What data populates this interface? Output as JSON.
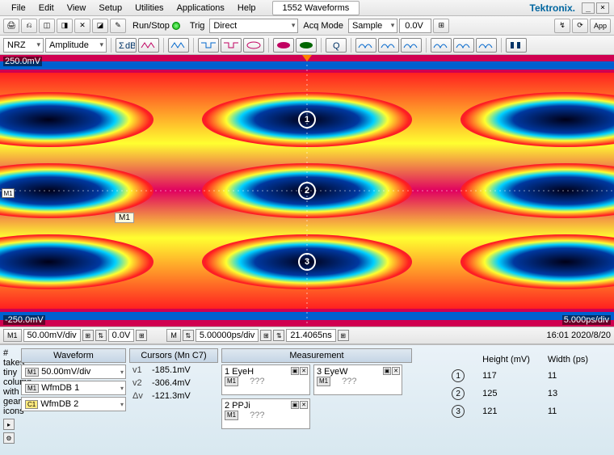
{
  "menu": {
    "items": [
      "File",
      "Edit",
      "View",
      "Setup",
      "Utilities",
      "Applications",
      "Help"
    ],
    "title": "1552 Waveforms",
    "brand": "Tektronix."
  },
  "toolbar1": {
    "runstop": "Run/Stop",
    "trig_label": "Trig",
    "trig_mode": "Direct",
    "acq_label": "Acq Mode",
    "acq_mode": "Sample",
    "voltage": "0.0V",
    "app_label": "App"
  },
  "toolbar2": {
    "mode_left": "NRZ",
    "mode_right": "Amplitude"
  },
  "plot": {
    "ytop": "250.0mV",
    "ybot": "-250.0mV",
    "timediv": "5.000ps/div",
    "m1_label": "M1",
    "markers": [
      "1",
      "2",
      "3"
    ]
  },
  "statusbar": {
    "m1_tag": "M1",
    "vdiv": "50.00mV/div",
    "voff": "0.0V",
    "m_tag": "M",
    "tdiv": "5.00000ps/div",
    "tpos": "21.4065ns",
    "datetime": "16:01 2020/8/20"
  },
  "panel": {
    "waveform": {
      "header": "Waveform",
      "items": [
        {
          "tag": "M1",
          "label": "50.00mV/div",
          "tagclass": ""
        },
        {
          "tag": "M1",
          "label": "WfmDB 1",
          "tagclass": ""
        },
        {
          "tag": "C1",
          "label": "WfmDB 2",
          "tagclass": "y"
        }
      ]
    },
    "cursors": {
      "header": "Cursors (Mn C7)",
      "rows": [
        {
          "k": "v1",
          "v": "-185.1mV"
        },
        {
          "k": "v2",
          "v": "-306.4mV"
        },
        {
          "k": "Δv",
          "v": "-121.3mV"
        }
      ]
    },
    "measurement": {
      "header": "Measurement",
      "boxes": [
        {
          "title": "1 EyeH",
          "tag": "M1",
          "val": "???"
        },
        {
          "title": "3 EyeW",
          "tag": "M1",
          "val": "???"
        },
        {
          "title": "2 PPJi",
          "tag": "M1",
          "val": "???"
        }
      ]
    },
    "results": {
      "height_label": "Height",
      "height_unit": "(mV)",
      "width_label": "Width",
      "width_unit": "(ps)",
      "rows": [
        {
          "n": "1",
          "h": "117",
          "w": "11"
        },
        {
          "n": "2",
          "h": "125",
          "w": "13"
        },
        {
          "n": "3",
          "h": "121",
          "w": "11"
        }
      ]
    }
  }
}
